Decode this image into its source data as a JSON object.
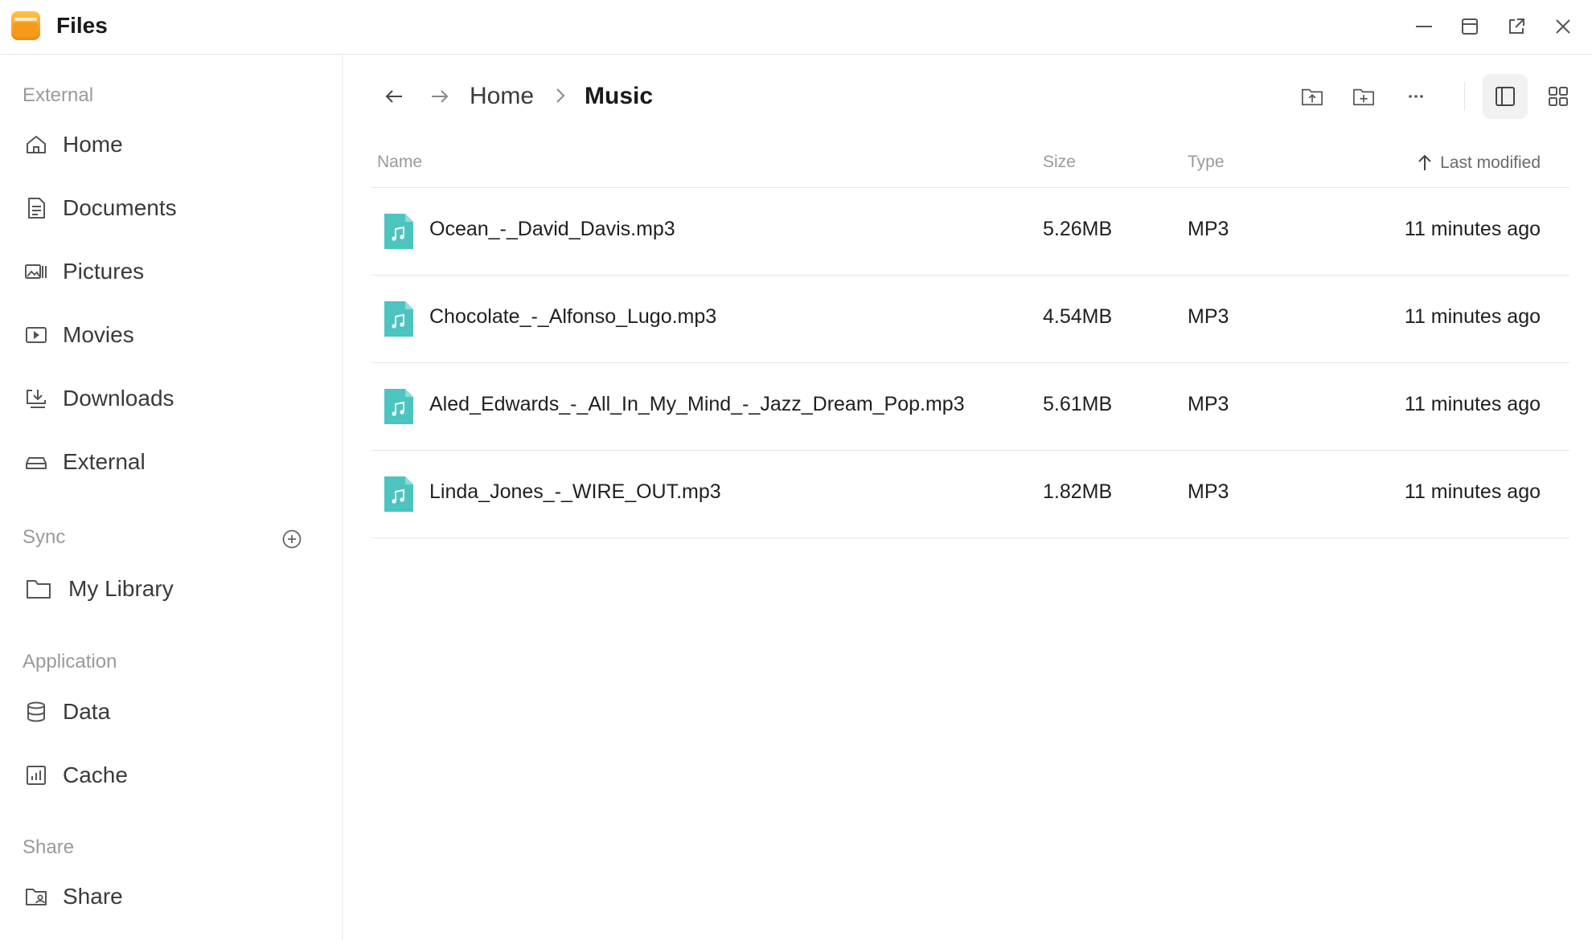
{
  "app": {
    "title": "Files"
  },
  "sidebar": {
    "external_label": "External",
    "external_items": [
      {
        "label": "Home",
        "icon": "home-icon"
      },
      {
        "label": "Documents",
        "icon": "document-icon"
      },
      {
        "label": "Pictures",
        "icon": "pictures-icon"
      },
      {
        "label": "Movies",
        "icon": "movie-icon"
      },
      {
        "label": "Downloads",
        "icon": "download-icon"
      },
      {
        "label": "External",
        "icon": "drive-icon"
      }
    ],
    "sync_label": "Sync",
    "sync_items": [
      {
        "label": "My Library",
        "icon": "folder-icon"
      }
    ],
    "application_label": "Application",
    "application_items": [
      {
        "label": "Data",
        "icon": "database-icon"
      },
      {
        "label": "Cache",
        "icon": "cache-icon"
      }
    ],
    "share_label": "Share",
    "share_items": [
      {
        "label": "Share",
        "icon": "shared-folder-icon"
      }
    ]
  },
  "breadcrumb": {
    "home": "Home",
    "current": "Music"
  },
  "table": {
    "headers": {
      "name": "Name",
      "size": "Size",
      "type": "Type",
      "modified": "Last modified"
    },
    "rows": [
      {
        "name": "Ocean_-_David_Davis.mp3",
        "size": "5.26MB",
        "type": "MP3",
        "modified": "11 minutes ago"
      },
      {
        "name": "Chocolate_-_Alfonso_Lugo.mp3",
        "size": "4.54MB",
        "type": "MP3",
        "modified": "11 minutes ago"
      },
      {
        "name": "Aled_Edwards_-_All_In_My_Mind_-_Jazz_Dream_Pop.mp3",
        "size": "5.61MB",
        "type": "MP3",
        "modified": "11 minutes ago"
      },
      {
        "name": "Linda_Jones_-_WIRE_OUT.mp3",
        "size": "1.82MB",
        "type": "MP3",
        "modified": "11 minutes ago"
      }
    ]
  },
  "colors": {
    "music_file": "#4cc4c0",
    "logo_orange": "#f7a21b",
    "icon_gray": "#555555"
  }
}
